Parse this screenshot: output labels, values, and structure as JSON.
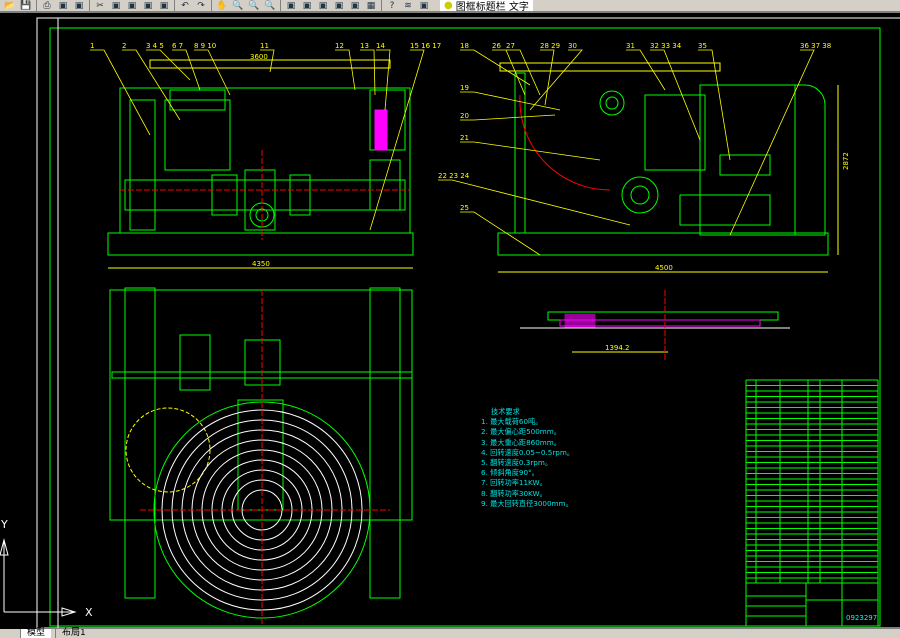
{
  "toolbar": {
    "icons": [
      "open-icon",
      "save-icon",
      "print-icon",
      "preview-icon",
      "publish-icon",
      "cut-icon",
      "copy-icon",
      "paste-icon",
      "match-properties-icon",
      "block-icon",
      "undo-icon",
      "redo-icon",
      "pan-icon",
      "zoom-realtime-icon",
      "zoom-window-icon",
      "zoom-previous-icon",
      "properties-icon",
      "design-center-icon",
      "tool-palettes-icon",
      "sheet-set-icon",
      "markup-icon",
      "calculator-icon",
      "help-icon",
      "layer-manager-icon",
      "layer-state-icon"
    ],
    "current_layer": "图框标题栏 文字"
  },
  "tabs": [
    {
      "label": "模型",
      "active": true
    },
    {
      "label": "布局1",
      "active": false
    }
  ],
  "drawing": {
    "balloons_front": [
      "1",
      "2",
      "3 4 5",
      "6 7",
      "8 9 10",
      "11",
      "12",
      "13",
      "14",
      "15 16 17"
    ],
    "balloons_side": [
      "18",
      "26",
      "27",
      "28 29",
      "30",
      "31",
      "32 33 34",
      "35",
      "36 37 38",
      "19",
      "20",
      "21",
      "22 23 24",
      "25"
    ],
    "dimensions": {
      "front_top": "3600",
      "front_bottom": "4350",
      "side_bottom": "4500",
      "side_height": "2872",
      "section_width": "1394.2"
    },
    "tech_requirements": {
      "title": "技术要求",
      "items": [
        "1. 最大载荷60吨。",
        "2. 最大偏心距500mm。",
        "3. 最大重心距860mm。",
        "4. 回转速度0.05~0.5rpm。",
        "5. 翻转速度0.3rpm。",
        "6. 倾斜角度90°。",
        "7. 回转功率11KW。",
        "8. 翻转功率30KW。",
        "9. 最大回转直径3000mm。"
      ]
    },
    "title_block": {
      "drawing_number": "0923297"
    },
    "ucs_labels": {
      "y": "Y",
      "x": "X"
    }
  },
  "colors": {
    "frame": "#00ff00",
    "leader": "#ffff00",
    "centerline": "#ff0000",
    "text": "#00e0e0",
    "hatch": "#ff00ff",
    "white": "#ffffff",
    "background": "#000000"
  }
}
